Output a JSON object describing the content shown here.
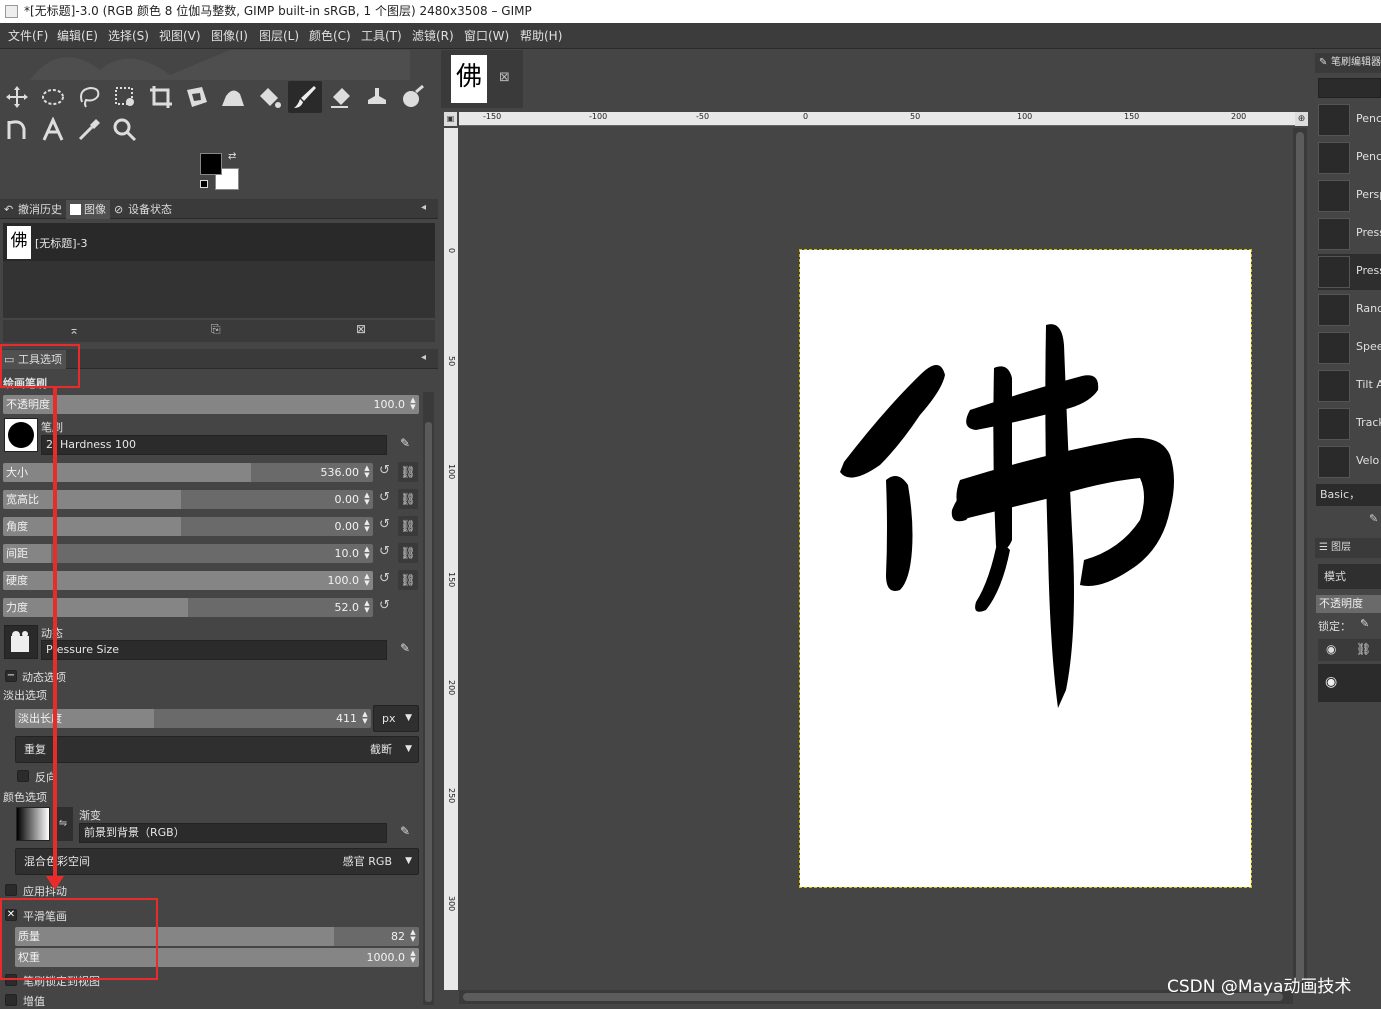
{
  "window": {
    "title": "*[无标题]-3.0 (RGB 颜色 8 位伽马整数, GIMP built-in sRGB, 1 个图层) 2480x3508 – GIMP"
  },
  "menu": [
    "文件(F)",
    "编辑(E)",
    "选择(S)",
    "视图(V)",
    "图像(I)",
    "图层(L)",
    "颜色(C)",
    "工具(T)",
    "滤镜(R)",
    "窗口(W)",
    "帮助(H)"
  ],
  "tools": [
    "move-icon",
    "ellipse-select-icon",
    "lasso-icon",
    "fuzzy-select-icon",
    "crop-icon",
    "transform-icon",
    "warp-icon",
    "bucket-fill-icon",
    "paintbrush-icon",
    "eraser-icon",
    "clone-icon",
    "smudge-icon",
    "paths-icon",
    "text-icon",
    "color-picker-icon",
    "zoom-icon"
  ],
  "colors": {
    "foreground": "#000000",
    "background": "#ffffff",
    "accent_red": "#e82c2c",
    "panel": "#454545"
  },
  "dock_tabs": [
    "撤消历史",
    "图像",
    "设备状态"
  ],
  "image_list": {
    "name": "[无标题]-3",
    "thumb_char": "佛"
  },
  "tool_options": {
    "tab_label": "工具选项",
    "tool_name": "绘画笔刷",
    "opacity": {
      "label": "不透明度",
      "value": "100.0",
      "fraction": 1.0
    },
    "brush": {
      "label": "笔刷",
      "name": "2. Hardness 100"
    },
    "size": {
      "label": "大小",
      "value": "536.00",
      "fraction": 0.6
    },
    "aspect": {
      "label": "宽高比",
      "value": "0.00",
      "fraction": 0.5
    },
    "angle": {
      "label": "角度",
      "value": "0.00",
      "fraction": 0.5
    },
    "spacing": {
      "label": "间距",
      "value": "10.0",
      "fraction": 0.13
    },
    "hardness": {
      "label": "硬度",
      "value": "100.0",
      "fraction": 1.0
    },
    "force": {
      "label": "力度",
      "value": "52.0",
      "fraction": 0.52
    },
    "dynamics": {
      "label": "动态",
      "name": "Pressure Size"
    },
    "dynamics_options_label": "动态选项",
    "fade_options_label": "淡出选项",
    "fade_length": {
      "label": "淡出长度",
      "value": "411",
      "fraction": 0.41,
      "unit": "px"
    },
    "repeat": {
      "label": "重复",
      "value": "截断"
    },
    "reverse_label": "反向",
    "color_options_label": "颜色选项",
    "gradient": {
      "label": "渐变",
      "name": "前景到背景（RGB）"
    },
    "blend_space": {
      "label": "混合色彩空间",
      "value": "感官 RGB"
    },
    "apply_jitter_label": "应用抖动",
    "smooth_stroke": {
      "label": "平滑笔画",
      "checked": true
    },
    "quality": {
      "label": "质量",
      "value": "82",
      "fraction": 0.82
    },
    "weight": {
      "label": "权重",
      "value": "1000.0",
      "fraction": 1.0
    },
    "lock_brush_label": "笔刷锁定到视图",
    "incremental_label": "增值"
  },
  "canvas": {
    "tab_char": "佛",
    "character": "佛",
    "hruler_ticks": [
      "-150",
      "-100",
      "-50",
      "0",
      "50",
      "100",
      "150",
      "200"
    ],
    "vruler_ticks": [
      "0",
      "50",
      "100",
      "150",
      "200",
      "250",
      "300"
    ]
  },
  "right_dock": {
    "brush_editor_tab": "笔刷编辑器",
    "dynamics_list": [
      "Penc",
      "Penc",
      "Persp",
      "Press",
      "Press",
      "Rand",
      "Spee",
      "Tilt A",
      "Track",
      "Velo"
    ],
    "basic_label": "Basic，",
    "layers_tab": "图层",
    "mode_label": "模式",
    "opacity_label": "不透明度",
    "lock_label": "锁定："
  },
  "watermark": "CSDN @Maya动画技术"
}
